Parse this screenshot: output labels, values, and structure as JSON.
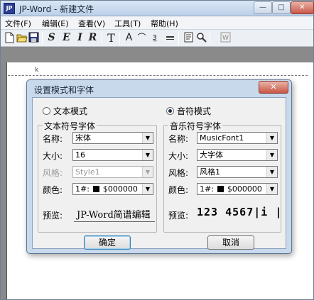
{
  "window": {
    "title": "JP-Word - 新建文件",
    "app_icon_text": "JP",
    "controls": {
      "min": "—",
      "max": "□",
      "close": "✕"
    }
  },
  "menu": [
    "文件(F)",
    "编辑(E)",
    "查看(V)",
    "工具(T)",
    "帮助(H)"
  ],
  "toolbar": {
    "icons": [
      "new-file-icon",
      "open-folder-icon",
      "save-icon",
      "format-s",
      "format-e",
      "format-i",
      "format-r",
      "text-tool-icon",
      "font-a-icon",
      "slur-icon",
      "small-number-icon",
      "page-setup-icon",
      "zoom-icon",
      "word-export-icon"
    ],
    "format_letters": [
      "S",
      "E",
      "I",
      "R"
    ],
    "text_tool": "T",
    "font_tool": "A",
    "slur_tool": "⌒",
    "small_tool": "3̲"
  },
  "dialog": {
    "title": "设置模式和字体",
    "close": "✕",
    "mode_text": "文本模式",
    "mode_music": "音符模式",
    "selected_mode": "music",
    "text_group": {
      "legend": "文本符号字体",
      "name_label": "名称:",
      "name_value": "宋体",
      "size_label": "大小:",
      "size_value": "16",
      "style_label": "风格:",
      "style_value": "Style1",
      "color_label": "颜色:",
      "color_prefix": "1#:",
      "color_value": "$000000",
      "preview_label": "预览:",
      "preview_text": "JP-Word简谱编辑"
    },
    "music_group": {
      "legend": "音乐符号字体",
      "name_label": "名称:",
      "name_value": "MusicFont1",
      "size_label": "大小:",
      "size_value": "大字体",
      "style_label": "风格:",
      "style_value": "风格1",
      "color_label": "颜色:",
      "color_prefix": "1#:",
      "color_value": "$000000",
      "preview_label": "预览:",
      "preview_text": "123 4567|i |"
    },
    "ok_label": "确定",
    "cancel_label": "取消"
  },
  "colors": {
    "swatch": "#000000",
    "dialog_frame": "#c8d9ec"
  }
}
